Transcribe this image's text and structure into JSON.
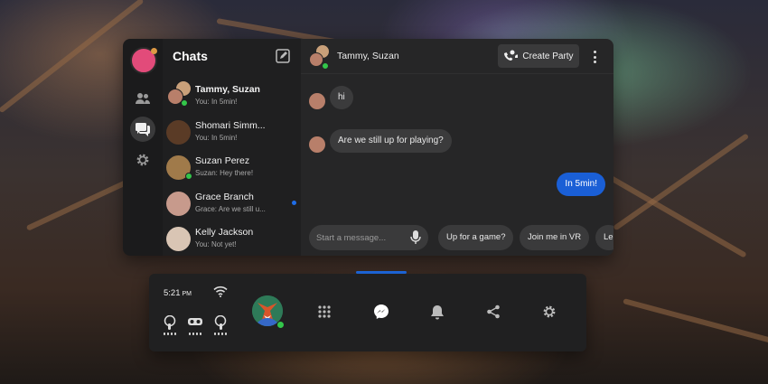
{
  "colors": {
    "accent": "#1a5fd6",
    "online": "#33c64a",
    "unread": "#1f6de8",
    "panel_bg": "#262627",
    "bubble_bg": "#3b3b3c"
  },
  "sidebar": {
    "items": [
      {
        "icon": "people-icon"
      },
      {
        "icon": "chat-bubbles-icon",
        "active": true
      },
      {
        "icon": "gear-icon"
      }
    ]
  },
  "chat_list": {
    "title": "Chats",
    "compose_icon": "compose-icon",
    "items": [
      {
        "name": "Tammy, Suzan",
        "preview": "You: In 5min!",
        "bold": true,
        "online": true
      },
      {
        "name": "Shomari Simm...",
        "preview": "You: In 5min!"
      },
      {
        "name": "Suzan Perez",
        "preview": "Suzan: Hey there!",
        "online": true
      },
      {
        "name": "Grace Branch",
        "preview": "Grace: Are we still u...",
        "unread": true
      },
      {
        "name": "Kelly Jackson",
        "preview": "You: Not yet!"
      }
    ]
  },
  "conversation": {
    "title": "Tammy, Suzan",
    "create_party_label": "Create Party",
    "messages": [
      {
        "from": "other",
        "text": "hi"
      },
      {
        "from": "other",
        "text": "Are we still up for playing?"
      },
      {
        "from": "me",
        "text": "In 5min!"
      }
    ],
    "composer_placeholder": "Start a message...",
    "quick_replies": [
      "Up for a game?",
      "Join me in VR",
      "Le"
    ]
  },
  "dock": {
    "time": "5:21",
    "time_suffix": "PM",
    "device_icons": [
      "controller-left-icon",
      "headset-icon",
      "controller-right-icon"
    ],
    "apps": [
      "app-grid-icon",
      "messenger-icon",
      "bell-icon",
      "share-icon",
      "gear-icon"
    ],
    "active_app": "messenger-icon"
  }
}
